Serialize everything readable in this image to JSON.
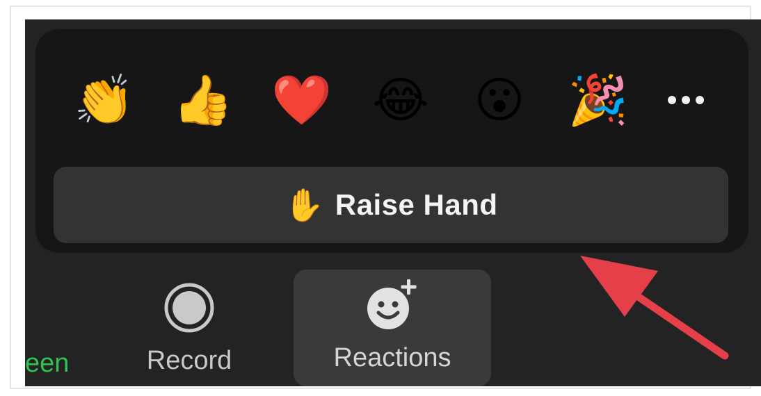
{
  "reactions_popup": {
    "emojis": [
      {
        "name": "clapping-hands",
        "glyph": "👏"
      },
      {
        "name": "thumbs-up",
        "glyph": "👍"
      },
      {
        "name": "heart",
        "glyph": "❤️"
      },
      {
        "name": "tears-of-joy",
        "glyph": "😂"
      },
      {
        "name": "surprised-face",
        "glyph": "😮"
      },
      {
        "name": "party-popper",
        "glyph": "🎉"
      }
    ],
    "more_icon": "more-icon",
    "raise_hand": {
      "icon_glyph": "✋",
      "label": "Raise Hand"
    }
  },
  "toolbar": {
    "left_partial_label": "een",
    "record_label": "Record",
    "reactions_label": "Reactions"
  },
  "colors": {
    "app_background": "#232323",
    "popup_background": "#161616",
    "raise_hand_background": "#333333",
    "active_tool_background": "#3a3a3a",
    "green_label": "#31c256",
    "annotation_arrow": "#e5404a"
  }
}
